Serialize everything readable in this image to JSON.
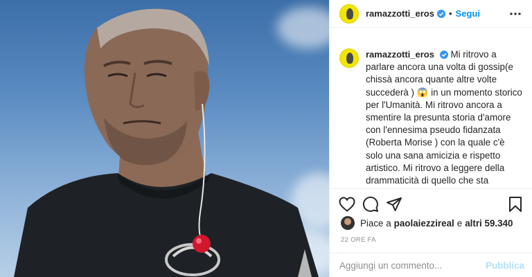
{
  "post": {
    "photo_alt": "",
    "author": {
      "username": "ramazzotti_eros",
      "verified": true
    },
    "header": {
      "separator": "•",
      "follow_label": "Segui"
    },
    "caption": {
      "username": "ramazzotti_eros",
      "text_part1": "Mi ritrovo a parlare ancora una volta di gossip(e chissà ancora quante altre volte succederà )",
      "emoji": "😱",
      "text_part2": "in un momento storico per l'Umanità. Mi ritrovo ancora a smentire la presunta storia d'amore con l'ennesima pseudo fidanzata (Roberta Morise ) con la quale c'è solo una sana amicizia e rispetto artistico. Mi ritrovo a leggere della drammaticità di quello che sta succedendo nel mondo e soprattutto"
    },
    "likes": {
      "prefix": "Piace a",
      "liker": "paolaiezzireal",
      "conjunction": "e",
      "others": "altri 59.340"
    },
    "timestamp": "22 ORE FA",
    "comment": {
      "placeholder": "Aggiungi un commento...",
      "publish_label": "Pubblica"
    },
    "icons": {
      "more": "more-horizontal-icon",
      "like": "heart-icon",
      "comment": "comment-bubble-icon",
      "share": "paper-plane-icon",
      "save": "bookmark-icon",
      "verified": "verified-badge-icon"
    },
    "colors": {
      "link_blue": "#0095f6",
      "verified_blue": "#3897f0",
      "publish_disabled": "#b2dffc",
      "muted_text": "#8e8e8e",
      "avatar_yellow": "#f2e600"
    }
  }
}
